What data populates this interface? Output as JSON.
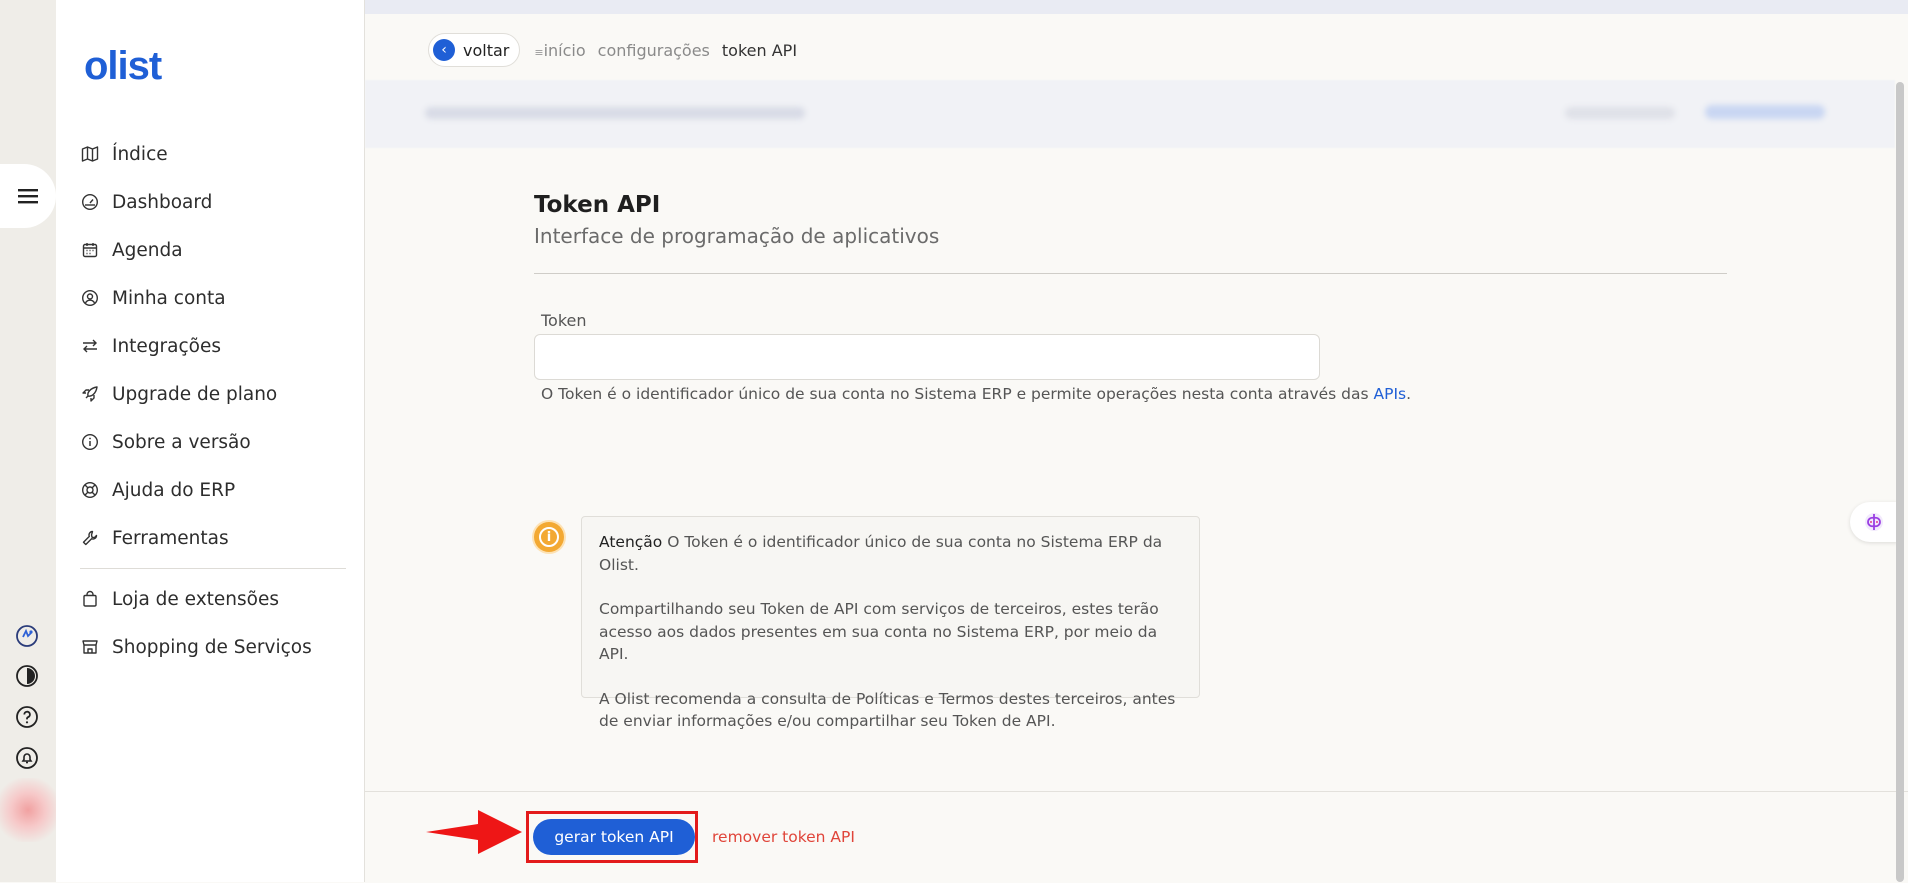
{
  "logo": "olist",
  "sidebar": {
    "items": [
      {
        "label": "Índice",
        "icon": "map-icon"
      },
      {
        "label": "Dashboard",
        "icon": "gauge-icon"
      },
      {
        "label": "Agenda",
        "icon": "calendar-icon"
      },
      {
        "label": "Minha conta",
        "icon": "user-circle-icon"
      },
      {
        "label": "Integrações",
        "icon": "arrows-exchange-icon"
      },
      {
        "label": "Upgrade de plano",
        "icon": "rocket-icon"
      },
      {
        "label": "Sobre a versão",
        "icon": "info-icon"
      },
      {
        "label": "Ajuda do ERP",
        "icon": "lifebuoy-icon"
      },
      {
        "label": "Ferramentas",
        "icon": "wrench-icon"
      }
    ],
    "extra_items": [
      {
        "label": "Loja de extensões",
        "icon": "shopping-bag-icon"
      },
      {
        "label": "Shopping de Serviços",
        "icon": "storefront-icon"
      }
    ]
  },
  "breadcrumb": {
    "back_label": "voltar",
    "items": [
      "início",
      "configurações"
    ],
    "current": "token API"
  },
  "main": {
    "title": "Token API",
    "subtitle": "Interface de programação de aplicativos",
    "token_field": {
      "label": "Token",
      "value": "",
      "helper_prefix": "O Token é o identificador único de sua conta no Sistema ERP e permite operações nesta conta através das ",
      "helper_link": "APIs",
      "helper_suffix": "."
    },
    "warning": {
      "heading": "Atenção",
      "line1": "O Token é o identificador único de sua conta no Sistema ERP da Olist.",
      "line2": "Compartilhando seu Token de API com serviços de terceiros, estes terão acesso aos dados presentes em sua conta no Sistema ERP, por meio da API.",
      "line3": "A Olist recomenda a consulta de Políticas e Termos destes terceiros, antes de enviar informações e/ou compartilhar seu Token de API."
    }
  },
  "footer": {
    "generate_label": "gerar token API",
    "remove_label": "remover token API"
  },
  "colors": {
    "brand": "#1f5fd6",
    "danger": "#e0453a",
    "warning": "#f3a933",
    "highlight": "#e31b1b"
  }
}
